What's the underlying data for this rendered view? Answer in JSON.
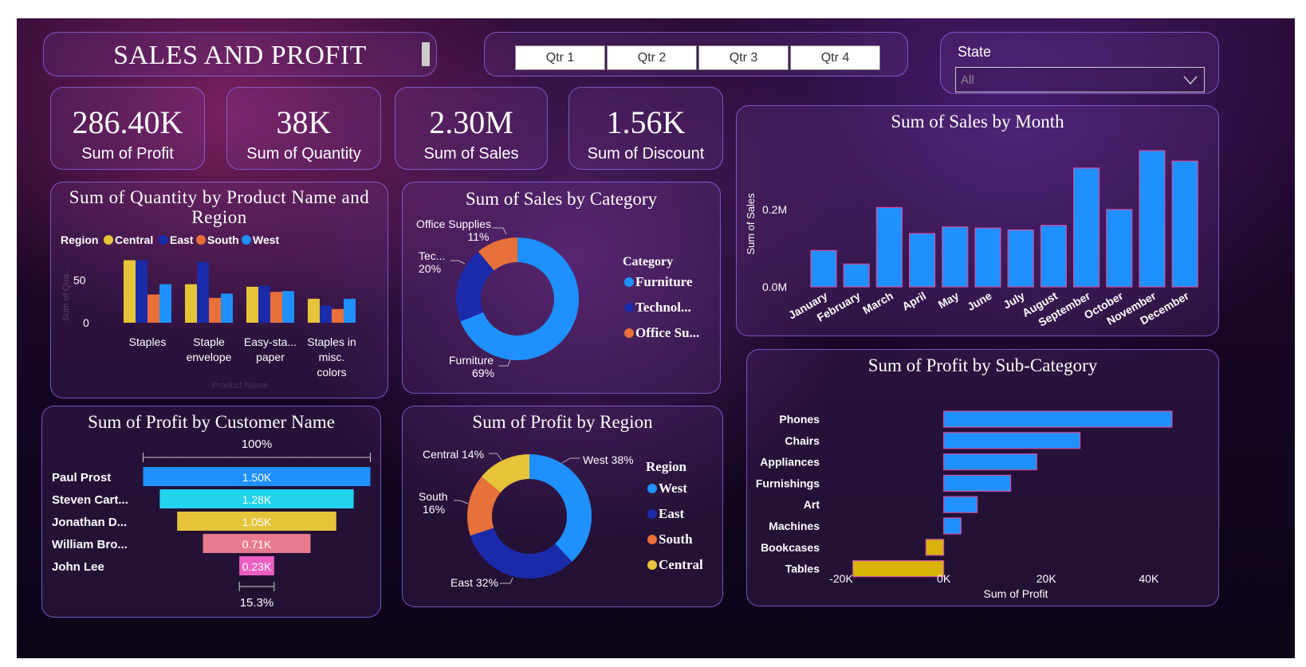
{
  "header": {
    "title": "SALES AND PROFIT"
  },
  "quarters": [
    "Qtr 1",
    "Qtr 2",
    "Qtr 3",
    "Qtr 4"
  ],
  "state_filter": {
    "label": "State",
    "value": "All"
  },
  "kpis": [
    {
      "value": "286.40K",
      "label": "Sum of Profit"
    },
    {
      "value": "38K",
      "label": "Sum of Quantity"
    },
    {
      "value": "2.30M",
      "label": "Sum of Sales"
    },
    {
      "value": "1.56K",
      "label": "Sum of Discount"
    }
  ],
  "colors": {
    "blue": "#1e90ff",
    "navy": "#1a2aa8",
    "orange": "#e8703a",
    "yellow": "#e6c43a",
    "cyan": "#22d3ee",
    "pink": "#e87a8f",
    "magenta": "#ec5fc1",
    "bar_outline": "#d14fa0"
  },
  "chart_data": [
    {
      "id": "qty_by_product_region",
      "type": "bar",
      "title": "Sum of Quantity by Product Name and Region",
      "legend_title": "Region",
      "ylabel": "Sum of Qua...",
      "xlabel": "Product Name",
      "yticks": [
        "50",
        "0"
      ],
      "ylim": [
        0,
        80
      ],
      "categories": [
        "Staples",
        "Staple envelope",
        "Easy-sta... paper",
        "Staples in misc. colors"
      ],
      "series": [
        {
          "name": "Central",
          "color": "#e6c43a",
          "values": [
            73,
            45,
            42,
            28
          ]
        },
        {
          "name": "East",
          "color": "#1a2aa8",
          "values": [
            73,
            71,
            43,
            20
          ]
        },
        {
          "name": "South",
          "color": "#e8703a",
          "values": [
            33,
            29,
            36,
            16
          ]
        },
        {
          "name": "West",
          "color": "#1e90ff",
          "values": [
            45,
            34,
            37,
            28
          ]
        }
      ]
    },
    {
      "id": "sales_by_category",
      "type": "pie",
      "title": "Sum of Sales by Category",
      "legend_title": "Category",
      "slices": [
        {
          "name": "Furniture",
          "legend": "Furniture",
          "value": 69,
          "label": "Furniture",
          "pct": "69%",
          "color": "#1e90ff"
        },
        {
          "name": "Technology",
          "legend": "Technol...",
          "value": 20,
          "label": "Tec...",
          "pct": "20%",
          "color": "#1a2aa8"
        },
        {
          "name": "Office Supplies",
          "legend": "Office Su...",
          "value": 11,
          "label": "Office Supplies",
          "pct": "11%",
          "color": "#e8703a"
        }
      ]
    },
    {
      "id": "profit_by_customer",
      "type": "bar",
      "title": "Sum of Profit by Customer Name",
      "top_label": "100%",
      "bottom_label": "15.3%",
      "categories": [
        "Paul Prost",
        "Steven Cart...",
        "Jonathan D...",
        "William Bro...",
        "John Lee"
      ],
      "values": [
        1500,
        1280,
        1050,
        710,
        230
      ],
      "labels": [
        "1.50K",
        "1.28K",
        "1.05K",
        "0.71K",
        "0.23K"
      ],
      "colors": [
        "#1e90ff",
        "#22d3ee",
        "#e6c43a",
        "#e87a8f",
        "#ec5fc1"
      ]
    },
    {
      "id": "profit_by_region",
      "type": "pie",
      "title": "Sum of Profit by Region",
      "legend_title": "Region",
      "slices": [
        {
          "name": "West",
          "value": 38,
          "label": "West 38%",
          "color": "#1e90ff"
        },
        {
          "name": "East",
          "value": 32,
          "label": "East 32%",
          "color": "#1a2aa8"
        },
        {
          "name": "South",
          "value": 16,
          "label": "South 16%",
          "color": "#e8703a"
        },
        {
          "name": "Central",
          "value": 14,
          "label": "Central 14%",
          "color": "#e6c43a"
        }
      ]
    },
    {
      "id": "sales_by_month",
      "type": "bar",
      "title": "Sum of Sales by Month",
      "ylabel": "Sum of Sales",
      "yticks": [
        {
          "v": 0.2,
          "label": "0.2M"
        },
        {
          "v": 0,
          "label": "0.0M"
        }
      ],
      "ylim": [
        0,
        0.35
      ],
      "categories": [
        "January",
        "February",
        "March",
        "April",
        "May",
        "June",
        "July",
        "August",
        "September",
        "October",
        "November",
        "December"
      ],
      "values": [
        0.094,
        0.059,
        0.205,
        0.138,
        0.155,
        0.152,
        0.147,
        0.159,
        0.307,
        0.2,
        0.352,
        0.325
      ],
      "color": "#1e90ff"
    },
    {
      "id": "profit_by_subcategory",
      "type": "bar",
      "orientation": "horizontal",
      "title": "Sum of Profit by Sub-Category",
      "xlabel": "Sum of Profit",
      "xticks": [
        {
          "v": -20000,
          "label": "-20K"
        },
        {
          "v": 0,
          "label": "0K"
        },
        {
          "v": 20000,
          "label": "20K"
        },
        {
          "v": 40000,
          "label": "40K"
        }
      ],
      "xlim": [
        -20000,
        45000
      ],
      "categories": [
        "Phones",
        "Chairs",
        "Appliances",
        "Furnishings",
        "Art",
        "Machines",
        "Bookcases",
        "Tables"
      ],
      "values": [
        44516,
        26590,
        18138,
        13059,
        6528,
        3385,
        -3473,
        -17725
      ],
      "pos_color": "#1e90ff",
      "neg_color": "#d8b40a"
    }
  ]
}
